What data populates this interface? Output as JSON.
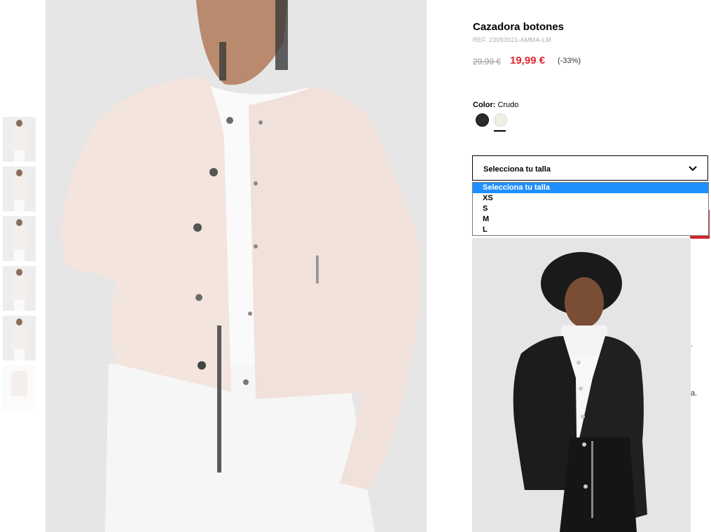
{
  "product": {
    "title": "Cazadora botones",
    "ref": "REF. 23093021-AMMA-LM",
    "price_old": "29,99 €",
    "price_new": "19,99 €",
    "discount": "(-33%)"
  },
  "color": {
    "label": "Color:",
    "value": "Crudo",
    "swatches": [
      "#2b2b2b",
      "#f1eee4"
    ]
  },
  "size": {
    "select_label": "Selecciona tu talla",
    "options": [
      "Selecciona tu talla",
      "XS",
      "S",
      "M",
      "L"
    ]
  },
  "side_fragments": [
    ".",
    "a."
  ]
}
